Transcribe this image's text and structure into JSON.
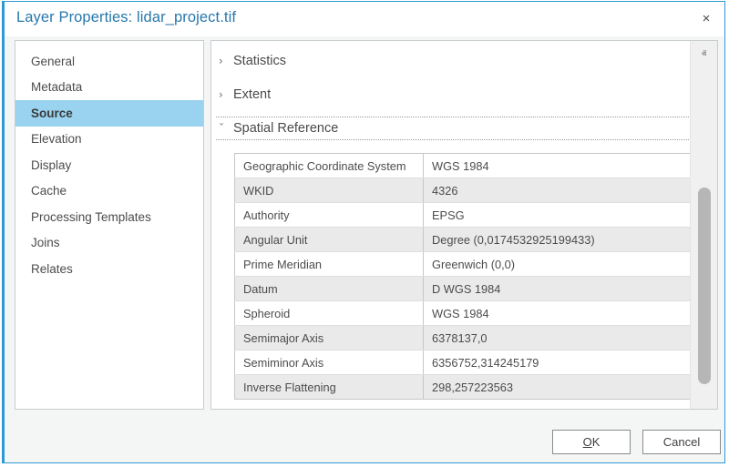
{
  "window": {
    "title": "Layer Properties: lidar_project.tif",
    "close_label": "×",
    "accent_color": "#2e9ad4",
    "title_color": "#2878ab"
  },
  "sidebar": {
    "items": [
      {
        "label": "General",
        "selected": false
      },
      {
        "label": "Metadata",
        "selected": false
      },
      {
        "label": "Source",
        "selected": true
      },
      {
        "label": "Elevation",
        "selected": false
      },
      {
        "label": "Display",
        "selected": false
      },
      {
        "label": "Cache",
        "selected": false
      },
      {
        "label": "Processing Templates",
        "selected": false
      },
      {
        "label": "Joins",
        "selected": false
      },
      {
        "label": "Relates",
        "selected": false
      }
    ],
    "selected_color": "#9ad3ef"
  },
  "content": {
    "sections": [
      {
        "label": "Statistics",
        "expanded": false,
        "chevron": "›"
      },
      {
        "label": "Extent",
        "expanded": false,
        "chevron": "›"
      },
      {
        "label": "Spatial Reference",
        "expanded": true,
        "chevron": "ˇ"
      }
    ],
    "table": {
      "rows": [
        {
          "name": "Geographic Coordinate System",
          "value": "WGS 1984"
        },
        {
          "name": "WKID",
          "value": "4326"
        },
        {
          "name": "Authority",
          "value": "EPSG"
        },
        {
          "name": "Angular Unit",
          "value": "Degree (0,0174532925199433)"
        },
        {
          "name": "Prime Meridian",
          "value": "Greenwich (0,0)"
        },
        {
          "name": "Datum",
          "value": "D WGS 1984"
        },
        {
          "name": "Spheroid",
          "value": "WGS 1984"
        },
        {
          "name": "Semimajor Axis",
          "value": "6378137,0"
        },
        {
          "name": "Semiminor Axis",
          "value": "6356752,314245179"
        },
        {
          "name": "Inverse Flattening",
          "value": "298,257223563"
        }
      ]
    },
    "scrollbar": {
      "up_glyph": "ⱏ",
      "down_glyph": "ⱟ"
    }
  },
  "footer": {
    "ok_accel": "O",
    "ok_rest": "K",
    "cancel_label": "Cancel"
  }
}
